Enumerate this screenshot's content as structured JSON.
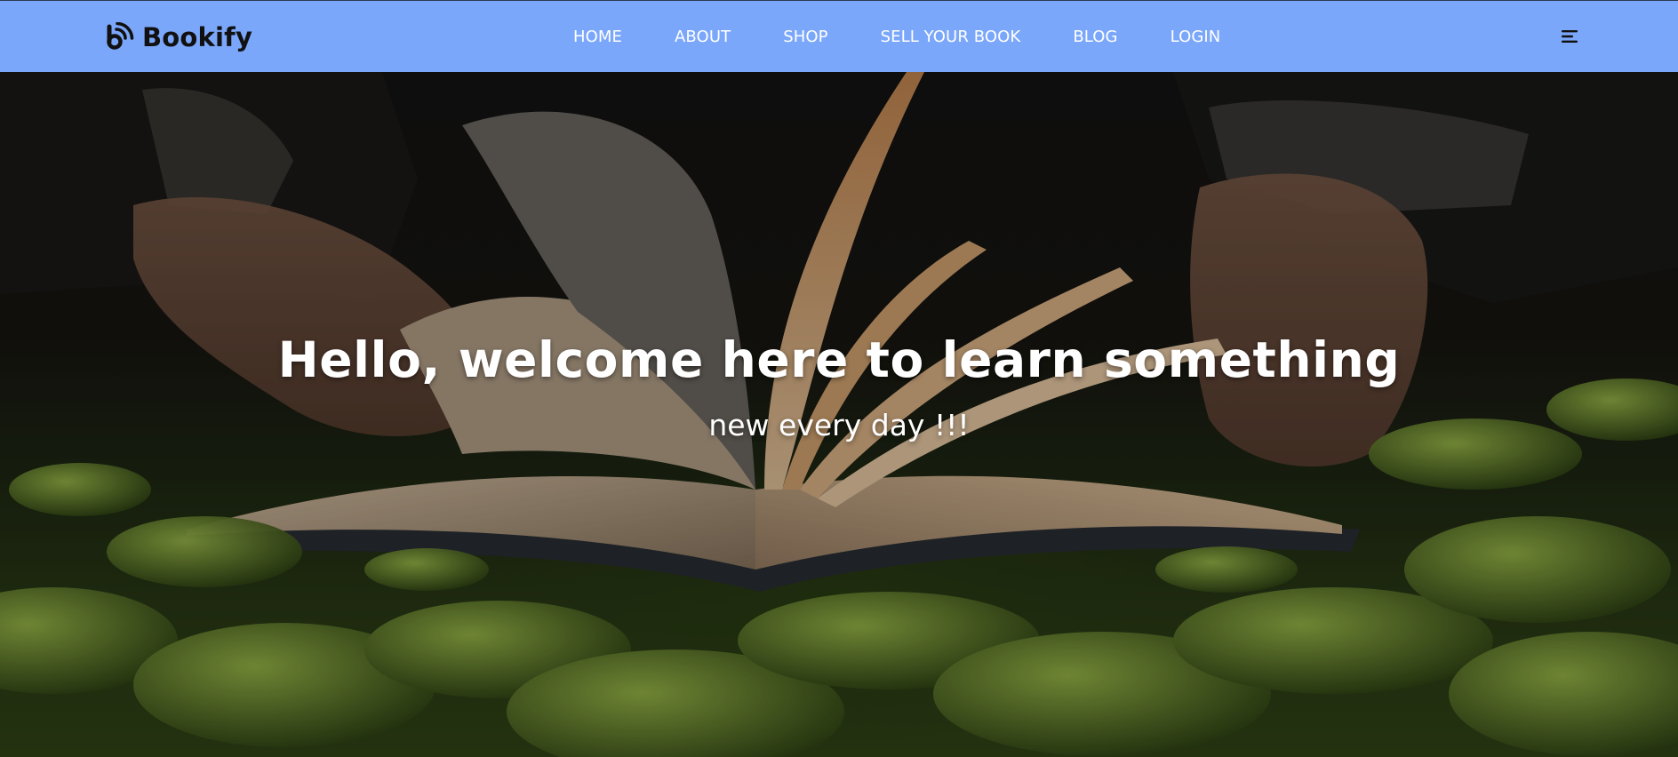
{
  "brand": {
    "name": "Bookify",
    "icon": "bookify-logo-icon"
  },
  "nav": {
    "items": [
      {
        "label": "HOME"
      },
      {
        "label": "ABOUT"
      },
      {
        "label": "SHOP"
      },
      {
        "label": "SELL YOUR BOOK"
      },
      {
        "label": "BLOG"
      },
      {
        "label": "LOGIN"
      }
    ],
    "menu_icon": "hamburger-menu-icon"
  },
  "hero": {
    "title": "Hello, welcome here to learn something",
    "subtitle": "new every day !!!",
    "background": "open-book-on-grass-photo"
  },
  "colors": {
    "navbar_bg": "#7ba7fb",
    "nav_text": "#ffffff",
    "brand_text": "#111111",
    "hero_text": "#ffffff"
  }
}
